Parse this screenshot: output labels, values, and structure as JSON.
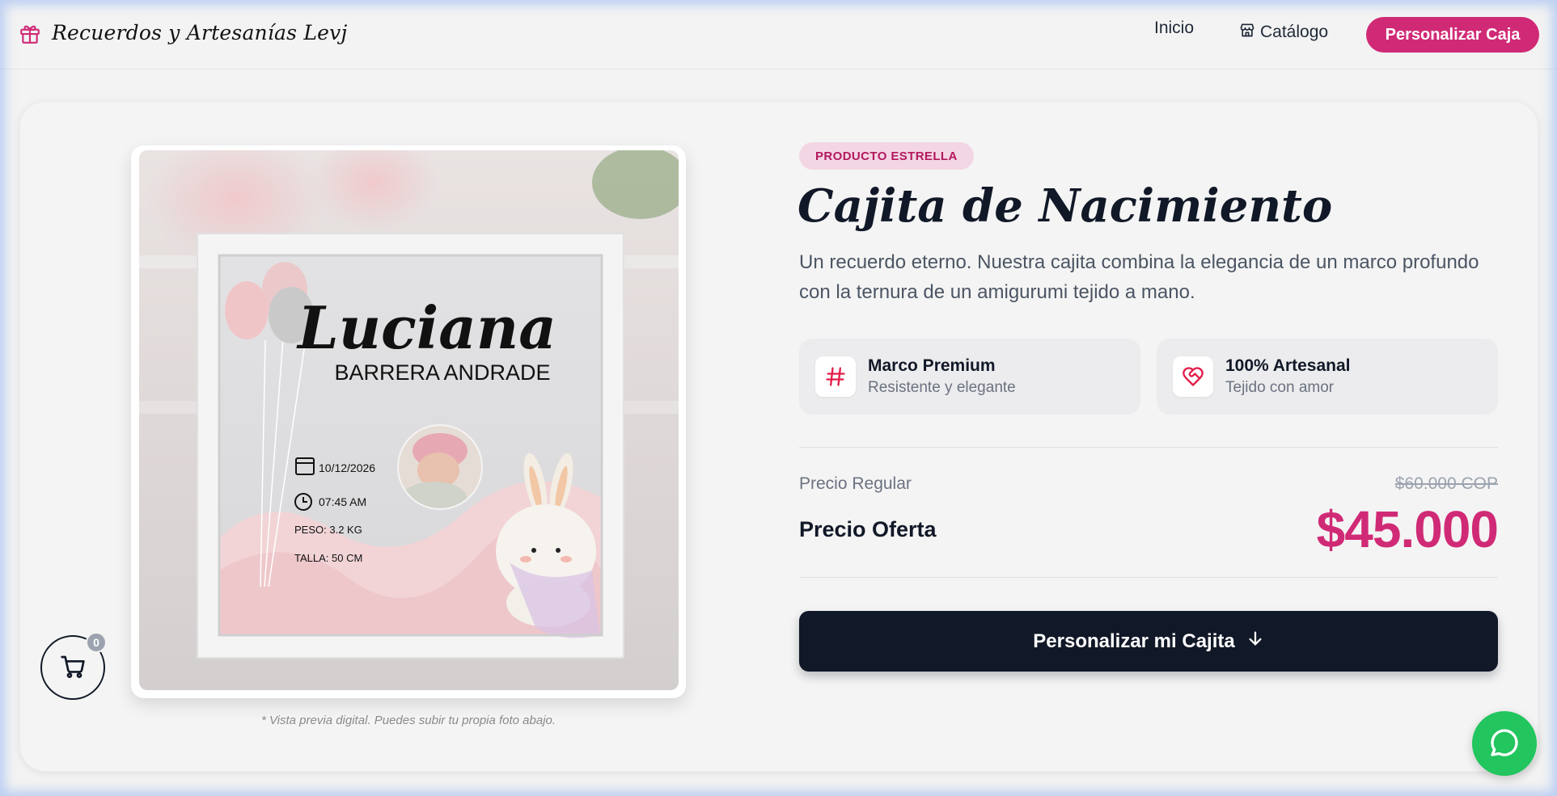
{
  "header": {
    "brand_name": "Recuerdos y Artesanías Levj",
    "nav": {
      "home": "Inicio",
      "catalog": "Catálogo"
    },
    "cta": "Personalizar Caja"
  },
  "product": {
    "badge": "PRODUCTO ESTRELLA",
    "title": "Cajita de Nacimiento",
    "description": "Un recuerdo eterno. Nuestra cajita combina la elegancia de un marco profundo con la ternura de un amigurumi tejido a mano.",
    "features": [
      {
        "title": "Marco Premium",
        "subtitle": "Resistente y elegante",
        "icon": "hash-icon"
      },
      {
        "title": "100% Artesanal",
        "subtitle": "Tejido con amor",
        "icon": "heart-handshake-icon"
      }
    ],
    "price": {
      "regular_label": "Precio Regular",
      "regular_value": "$60.000 COP",
      "offer_label": "Precio Oferta",
      "offer_value": "$45.000"
    },
    "cta": "Personalizar mi Cajita"
  },
  "preview": {
    "name": "Luciana",
    "surname": "BARRERA ANDRADE",
    "date": "10/12/2026",
    "time": "07:45 AM",
    "weight": "PESO: 3.2 KG",
    "height": "TALLA: 50 CM",
    "caption": "* Vista previa digital. Puedes subir tu propia foto abajo."
  },
  "cart": {
    "count": "0"
  },
  "colors": {
    "accent": "#d02a76",
    "dark": "#111827",
    "whatsapp": "#22c55e"
  }
}
